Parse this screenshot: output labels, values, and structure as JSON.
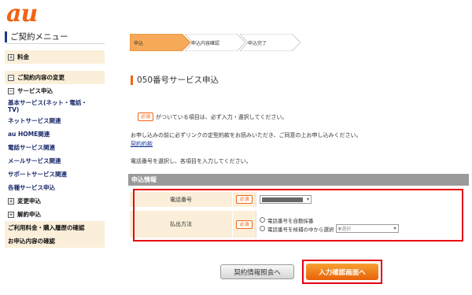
{
  "brand": {
    "logo_text": "au",
    "color": "#f06414"
  },
  "sidebar": {
    "heading": "ご契約メニュー",
    "items": [
      {
        "label": "料金",
        "expand": "+"
      },
      {
        "label": "ご契約内容の変更",
        "expand": "−"
      },
      {
        "label": "サービス申込",
        "expand": "−"
      },
      {
        "label": "基本サービス(ネット・電話・TV)"
      },
      {
        "label": "ネットサービス関連"
      },
      {
        "label": "au HOME関連"
      },
      {
        "label": "電話サービス関連"
      },
      {
        "label": "メールサービス関連"
      },
      {
        "label": "サポートサービス関連"
      },
      {
        "label": "各種サービス申込"
      },
      {
        "label": "変更申込",
        "expand": "+"
      },
      {
        "label": "解約申込",
        "expand": "+"
      },
      {
        "label": "ご利用料金・購入履歴の確認"
      },
      {
        "label": "お申込内容の確認"
      }
    ]
  },
  "steps": [
    "申込",
    "申込内容確認",
    "申込完了"
  ],
  "page": {
    "title": "050番号サービス申込",
    "required_badge": "必須",
    "required_note": "がついている項目は、必ず入力・選択してください。",
    "notice": "お申し込みの前に必ずリンクの定型約款をお読みいただき、ご同意の上お申し込みください。",
    "terms_link": "契約約款",
    "instruction": "電話番号を選択し、各項目を入力してください。",
    "section_title": "申込情報"
  },
  "form": {
    "phone_label": "電話番号",
    "phone_value": "",
    "method_label": "払出方法",
    "radio_auto": "電話番号を自動採番",
    "radio_choose": "電話番号を候補の中から選択",
    "choose_placeholder": "▼選択"
  },
  "buttons": {
    "contract_info": "契約情報照会へ",
    "confirm": "入力確認画面へ"
  }
}
